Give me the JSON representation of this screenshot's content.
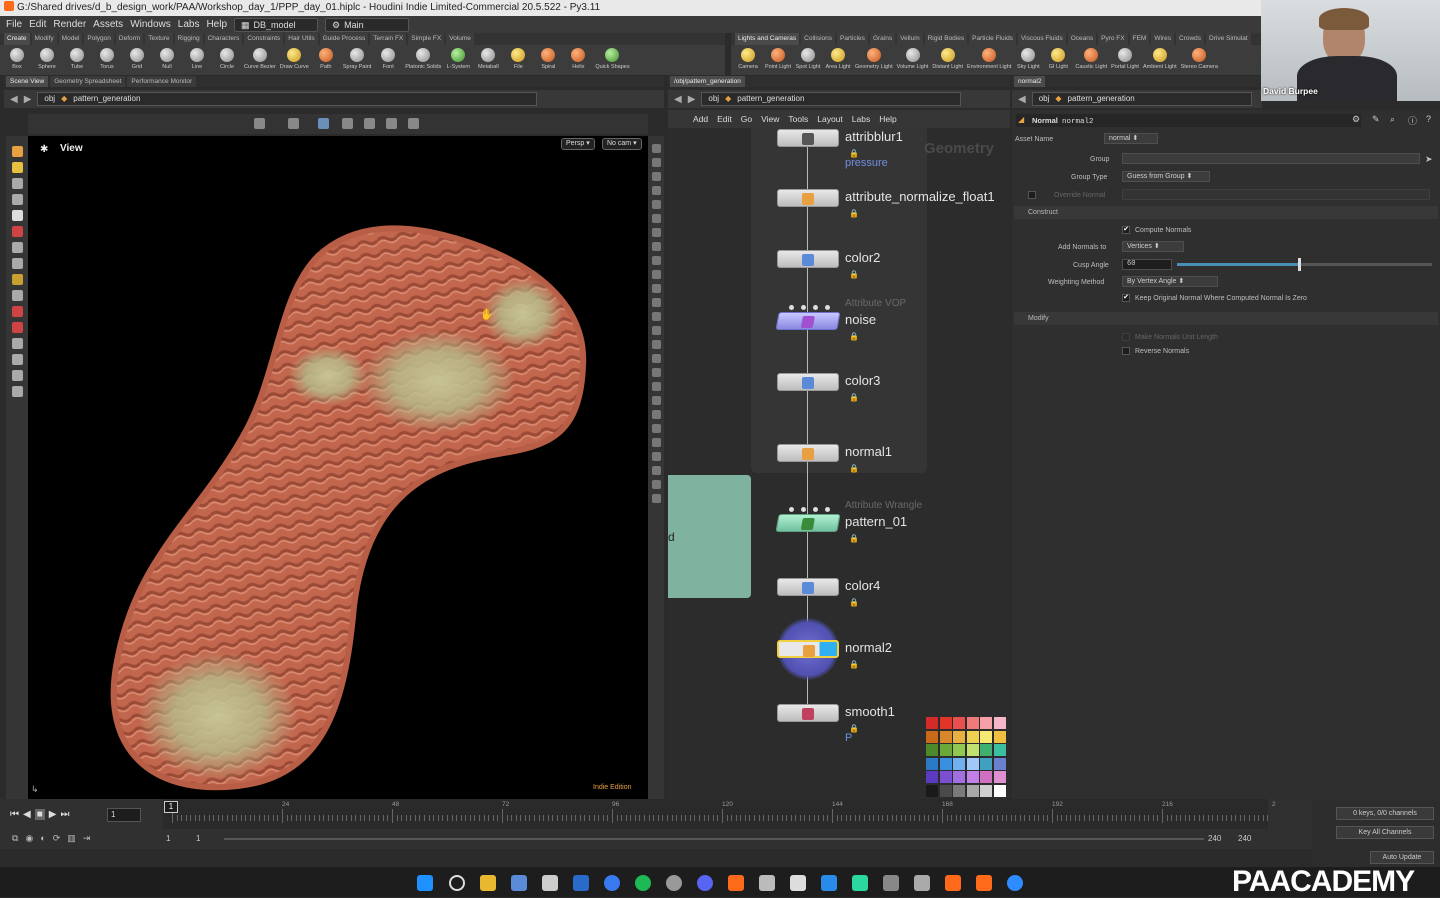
{
  "window": {
    "title": "G:/Shared drives/d_b_design_work/PAA/Workshop_day_1/PPP_day_01.hiplc - Houdini Indie Limited-Commercial 20.5.522 - Py3.11"
  },
  "menubar": {
    "items": [
      "File",
      "Edit",
      "Render",
      "Assets",
      "Windows",
      "Labs",
      "Help"
    ],
    "desktop": "DB_model",
    "layout": "Main"
  },
  "shelf_left": {
    "tabs": [
      "Create",
      "Modify",
      "Model",
      "Polygon",
      "Deform",
      "Texture",
      "Rigging",
      "Characters",
      "Constraints",
      "Hair Utils",
      "Guide Process",
      "Terrain FX",
      "Simple FX",
      "Volume"
    ],
    "tools": [
      "Box",
      "Sphere",
      "Tube",
      "Torus",
      "Grid",
      "Null",
      "Line",
      "Circle",
      "Curve Bezier",
      "Draw Curve",
      "Path",
      "Spray Paint",
      "Font",
      "Platonic Solids",
      "L-System",
      "Metaball",
      "File",
      "Spiral",
      "Helix",
      "Quick Shapes"
    ]
  },
  "shelf_right": {
    "tabs": [
      "Lights and Cameras",
      "Collisions",
      "Particles",
      "Grains",
      "Vellum",
      "Rigid Bodies",
      "Particle Fluids",
      "Viscous Fluids",
      "Oceans",
      "Pyro FX",
      "FEM",
      "Wires",
      "Crowds",
      "Drive Simulat"
    ],
    "tools": [
      "Camera",
      "Point Light",
      "Spot Light",
      "Area Light",
      "Geometry Light",
      "Volume Light",
      "Distant Light",
      "Environment Light",
      "Sky Light",
      "GI Light",
      "Caustic Light",
      "Portal Light",
      "Ambient Light",
      "Stereo Camera"
    ]
  },
  "left_pane": {
    "tabs": [
      "Scene View",
      "Geometry Spreadsheet",
      "Performance Monitor"
    ],
    "path_root": "obj",
    "path_node": "pattern_generation",
    "view_label": "View",
    "persp": "Persp",
    "cam": "No cam",
    "edition": "Indie Edition"
  },
  "network_pane": {
    "tab": "/obj/pattern_generation",
    "path_root": "obj",
    "path_node": "pattern_generation",
    "menu": [
      "Add",
      "Edit",
      "Go",
      "View",
      "Tools",
      "Layout",
      "Labs",
      "Help"
    ],
    "context_label": "Geometry",
    "side_text": "d",
    "nodes": [
      {
        "name": "attribblur1",
        "sub": "pressure"
      },
      {
        "name": "attribute_normalize_float1",
        "sub": ""
      },
      {
        "name": "color2",
        "sub": ""
      },
      {
        "name": "noise",
        "type": "Attribute VOP"
      },
      {
        "name": "color3",
        "sub": ""
      },
      {
        "name": "normal1",
        "sub": ""
      },
      {
        "name": "pattern_01",
        "type": "Attribute Wrangle"
      },
      {
        "name": "color4",
        "sub": ""
      },
      {
        "name": "normal2",
        "sub": ""
      },
      {
        "name": "smooth1",
        "sub": "P"
      }
    ],
    "palette_colors": [
      "#d42a2a",
      "#e3342a",
      "#e85050",
      "#f07a7a",
      "#f4a0a8",
      "#f6b8c8",
      "#c96a1a",
      "#d9872a",
      "#e8b040",
      "#f0d050",
      "#f6e870",
      "#f0c040",
      "#4a8a2a",
      "#6aa83a",
      "#90c850",
      "#c0e070",
      "#40b070",
      "#3ac0a0",
      "#2a7ac8",
      "#3a90e0",
      "#70b0f0",
      "#a0c8f8",
      "#40a0c0",
      "#6a80d0",
      "#5a3ac0",
      "#7a50d0",
      "#a070e0",
      "#c080e8",
      "#d070c0",
      "#e090d0",
      "#1a1a1a",
      "#4a4a4a",
      "#7a7a7a",
      "#a8a8a8",
      "#d0d0d0",
      "#ffffff"
    ]
  },
  "params": {
    "tab": "normal2",
    "path_root": "obj",
    "path_node": "pattern_generation",
    "node_type": "Normal",
    "node_name": "normal2",
    "asset_name_label": "Asset Name",
    "asset_name_value": "normal",
    "group_label": "Group",
    "group_type_label": "Group Type",
    "group_type_value": "Guess from Group",
    "override_normal_label": "Override Normal",
    "construct_label": "Construct",
    "compute_normals_label": "Compute Normals",
    "add_normals_label": "Add Normals to",
    "add_normals_value": "Vertices",
    "cusp_angle_label": "Cusp Angle",
    "cusp_angle_value": "60",
    "cusp_fraction": 0.48,
    "weighting_label": "Weighting Method",
    "weighting_value": "By Vertex Angle",
    "keep_original_label": "Keep Original Normal Where Computed Normal Is Zero",
    "modify_label": "Modify",
    "make_unit_label": "Make Normals Unit Length",
    "reverse_label": "Reverse Normals"
  },
  "timeline": {
    "current_frame": "1",
    "ticks": [
      "1",
      "24",
      "48",
      "72",
      "96",
      "120",
      "144",
      "168",
      "192",
      "216",
      "2"
    ],
    "start_frame": "1",
    "start_frame2": "1",
    "end_frame": "240",
    "end_frame2": "240",
    "keys_info": "0 keys, 0/0 channels",
    "key_all": "Key All Channels",
    "auto_update": "Auto Update"
  },
  "webcam": {
    "name": "David Burpee"
  },
  "brand": {
    "text": "PAACADEMY"
  }
}
